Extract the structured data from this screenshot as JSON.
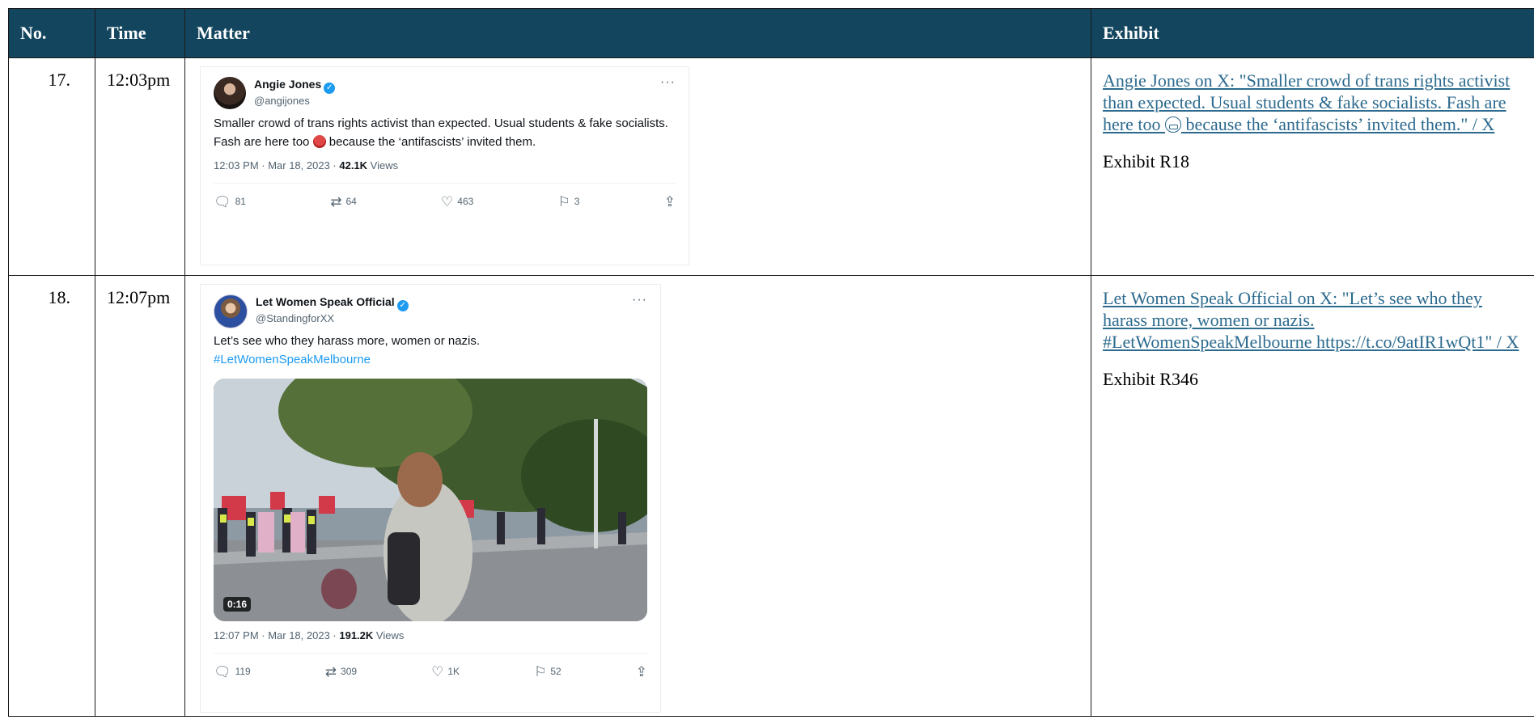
{
  "headers": {
    "no": "No.",
    "time": "Time",
    "matter": "Matter",
    "exhibit": "Exhibit"
  },
  "colors": {
    "header_bg": "#13465e",
    "link": "#2c6a8e",
    "twitter_blue": "#1d9bf0"
  },
  "rows": [
    {
      "no": "17.",
      "time": "12:03pm",
      "tweet": {
        "display_name": "Angie Jones",
        "handle": "@angijones",
        "text_part1": "Smaller crowd of trans rights activist than expected. Usual students & fake socialists. Fash are here too ",
        "text_part2": " because the ‘antifascists’ invited them.",
        "emoji": "angry-face-icon",
        "meta_time": "12:03 PM · Mar 18, 2023 · ",
        "views_count": "42.1K",
        "views_label": " Views",
        "replies": "81",
        "retweets": "64",
        "likes": "463",
        "bookmarks": "3"
      },
      "exhibit_link_part1": "Angie Jones on X: \"Smaller crowd of trans rights activist than expected. Usual students & fake socialists. Fash are here too ",
      "exhibit_link_part2": " because the ‘antifascists’ invited them.\" / X",
      "exhibit_ref": "Exhibit R18"
    },
    {
      "no": "18.",
      "time": "12:07pm",
      "tweet": {
        "display_name": "Let Women Speak Official",
        "handle": "@StandingforXX",
        "text": "Let’s see who they harass more, women or nazis.",
        "hashtag": "#LetWomenSpeakMelbourne",
        "video_duration": "0:16",
        "meta_time": "12:07 PM · Mar 18, 2023 · ",
        "views_count": "191.2K",
        "views_label": " Views",
        "replies": "119",
        "retweets": "309",
        "likes": "1K",
        "bookmarks": "52"
      },
      "exhibit_link": "Let Women Speak Official on X: \"Let’s see who they harass more, women or nazis. #LetWomenSpeakMelbourne https://t.co/9atIR1wQt1\" / X",
      "exhibit_ref": "Exhibit R346"
    }
  ]
}
